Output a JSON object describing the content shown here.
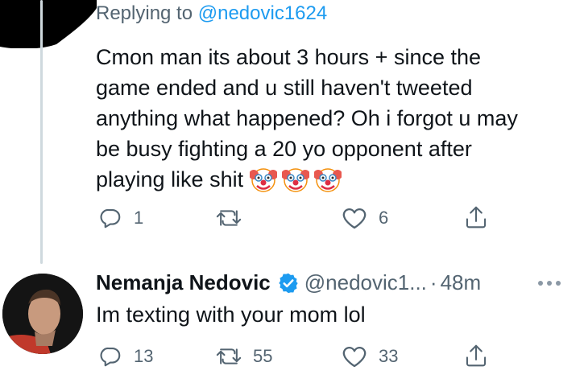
{
  "reply_tweet": {
    "replying_prefix": "Replying to",
    "replying_handle": "@nedovic1624",
    "text": "Cmon man its about 3 hours + since the\ngame ended and u still haven't tweeted\nanything what happened? Oh i forgot u may\nbe busy fighting a 20 yo opponent after\nplaying like shit",
    "emoji": [
      "clown-face",
      "clown-face",
      "clown-face"
    ],
    "actions": {
      "reply_count": "1",
      "retweet_count": "",
      "like_count": "6"
    }
  },
  "response_tweet": {
    "name": "Nemanja Nedovic",
    "verified": true,
    "handle": "@nedovic1...",
    "separator": "·",
    "time": "48m",
    "text": "Im texting with your mom lol",
    "actions": {
      "reply_count": "13",
      "retweet_count": "55",
      "like_count": "33"
    }
  },
  "colors": {
    "link_blue": "#1d9bf0",
    "secondary_text": "#536471",
    "primary_text": "#0f1419",
    "thread_line": "#cfd9de"
  },
  "icons": [
    "reply-icon",
    "retweet-icon",
    "like-icon",
    "share-icon",
    "verified-badge-icon",
    "more-icon"
  ]
}
